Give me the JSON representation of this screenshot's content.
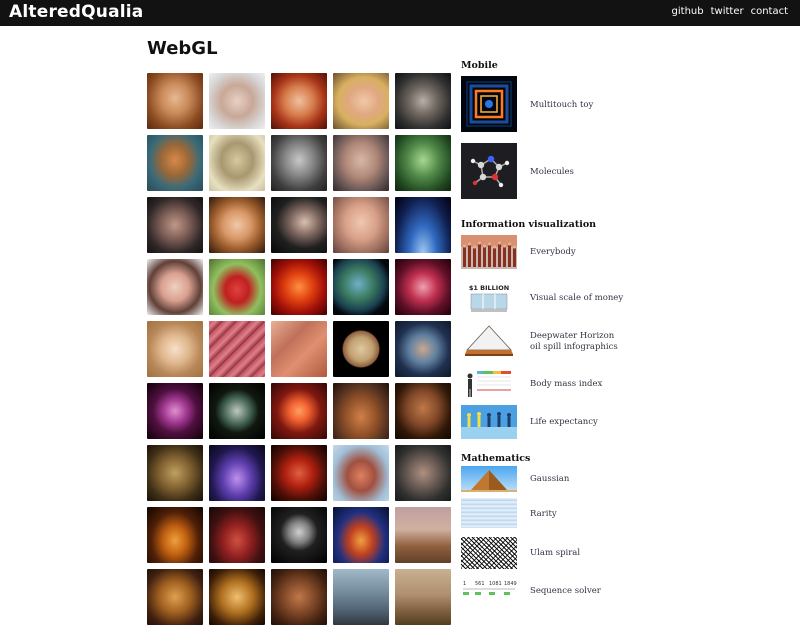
{
  "header": {
    "brand": "AlteredQualia",
    "nav": [
      "github",
      "twitter",
      "contact"
    ]
  },
  "main": {
    "title": "WebGL",
    "thumbnail_grid": {
      "columns": 5,
      "rows": [
        [
          "Botticelli Venus face",
          "woman portrait face",
          "red-haired woman face",
          "blonde woman face",
          "dark-haired man face"
        ],
        [
          "Van Gogh self-portrait",
          "Mick Jagger portrait",
          "Einstein portrait",
          "bald man head",
          "green-lit face"
        ],
        [
          "girl face",
          "smiling young woman",
          "woman in shadow",
          "man face",
          "space station over Earth"
        ],
        [
          "smiling woman",
          "red vintage car",
          "figures in red fire",
          "Earth globe",
          "red particles scene"
        ],
        [
          "fluffy cat",
          "pink crystal field",
          "pink rock texture",
          "Jupiter",
          "soldier character"
        ],
        [
          "purple glowing sphere",
          "dark Earth",
          "doorway with light figure",
          "orc warriors",
          "dark portrait"
        ],
        [
          "bronze cubes",
          "purple stage figures",
          "red character",
          "three soldiers",
          "dark man face"
        ],
        [
          "fire particles",
          "red army figures",
          "skull",
          "blue fire figures",
          "desert vehicle"
        ],
        [
          "golden lights",
          "glowing particles",
          "city scene",
          "city road",
          "desert town"
        ]
      ]
    }
  },
  "sidebar": {
    "sections": [
      {
        "title": "Mobile",
        "items": [
          {
            "label": "Multitouch toy",
            "icon": "multitouch-toy-icon"
          },
          {
            "label": "Molecules",
            "icon": "molecules-icon"
          }
        ]
      },
      {
        "title": "Information visualization",
        "items": [
          {
            "label": "Everybody",
            "icon": "everybody-icon"
          },
          {
            "label": "Visual scale of money",
            "icon": "money-scale-icon",
            "thumb_text": "$1 BILLION"
          },
          {
            "label": "Deepwater Horizon\noil spill infographics",
            "icon": "oil-pyramid-icon"
          },
          {
            "label": "Body mass index",
            "icon": "bmi-icon"
          },
          {
            "label": "Life expectancy",
            "icon": "life-expectancy-icon"
          }
        ]
      },
      {
        "title": "Mathematics",
        "items": [
          {
            "label": "Gaussian",
            "icon": "gaussian-icon"
          },
          {
            "label": "Rarity",
            "icon": "rarity-icon"
          },
          {
            "label": "Ulam spiral",
            "icon": "ulam-spiral-icon"
          },
          {
            "label": "Sequence solver",
            "icon": "sequence-solver-icon",
            "thumb_text": [
              "1",
              "561",
              "1081",
              "1849"
            ]
          }
        ]
      }
    ]
  },
  "colors": {
    "topbar": "#121212",
    "header_text": "#ffffff",
    "link_text": "#333344"
  }
}
